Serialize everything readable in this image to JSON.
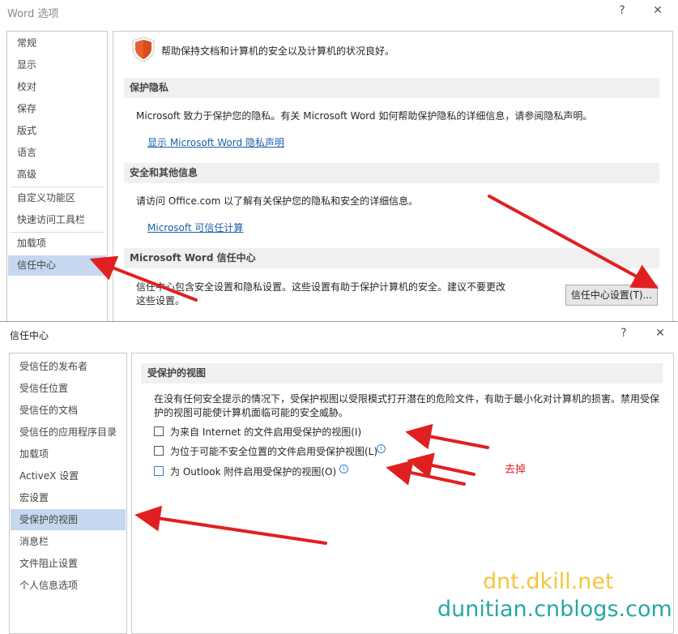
{
  "word_options": {
    "title": "Word 选项",
    "help": "?",
    "close": "✕",
    "nav": [
      "常规",
      "显示",
      "校对",
      "保存",
      "版式",
      "语言",
      "高级",
      "自定义功能区",
      "快速访问工具栏",
      "加载项",
      "信任中心"
    ],
    "selected_index": 10,
    "intro": "帮助保持文档和计算机的安全以及计算机的状况良好。",
    "sections": {
      "privacy": {
        "header": "保护隐私",
        "text": "Microsoft 致力于保护您的隐私。有关 Microsoft Word 如何帮助保护隐私的详细信息，请参阅隐私声明。",
        "link": "显示 Microsoft Word 隐私声明"
      },
      "security": {
        "header": "安全和其他信息",
        "text": "请访问 Office.com  以了解有关保护您的隐私和安全的详细信息。",
        "link": "Microsoft 可信任计算"
      },
      "trust_center": {
        "header": "Microsoft Word 信任中心",
        "text_line1": "信任中心包含安全设置和隐私设置。这些设置有助于保护计算机的安全。建议不要更改",
        "text_line2": "这些设置。",
        "button": "信任中心设置(T)..."
      }
    }
  },
  "trust_center": {
    "title": "信任中心",
    "help": "?",
    "close": "✕",
    "nav": [
      "受信任的发布者",
      "受信任位置",
      "受信任的文档",
      "受信任的应用程序目录",
      "加载项",
      "ActiveX 设置",
      "宏设置",
      "受保护的视图",
      "消息栏",
      "文件阻止设置",
      "个人信息选项"
    ],
    "selected_index": 7,
    "section_header": "受保护的视图",
    "paragraph_line1": "在没有任何安全提示的情况下，受保护视图以受限模式打开潜在的危险文件，有助于最小化对计算机的损害。禁用受保",
    "paragraph_line2": "护的视图可能使计算机面临可能的安全威胁。",
    "options": [
      {
        "label": "为来自 Internet 的文件启用受保护的视图(I)",
        "checked": false,
        "info": false
      },
      {
        "label": "为位于可能不安全位置的文件启用受保护视图(L)",
        "checked": false,
        "info": true
      },
      {
        "label": "为 Outlook 附件启用受保护的视图(O)",
        "checked": false,
        "info": true
      }
    ]
  },
  "annotation": {
    "note": "去掉",
    "color": "#e02020"
  },
  "watermark": {
    "line1": "dnt.dkill.net",
    "line2": "dunitian.cnblogs.com",
    "color1": "#f4c63c",
    "color2": "#28a7a3"
  },
  "colors": {
    "selection": "#c5d8ef",
    "link": "#1f5ea8",
    "shield": "#e8602c"
  }
}
